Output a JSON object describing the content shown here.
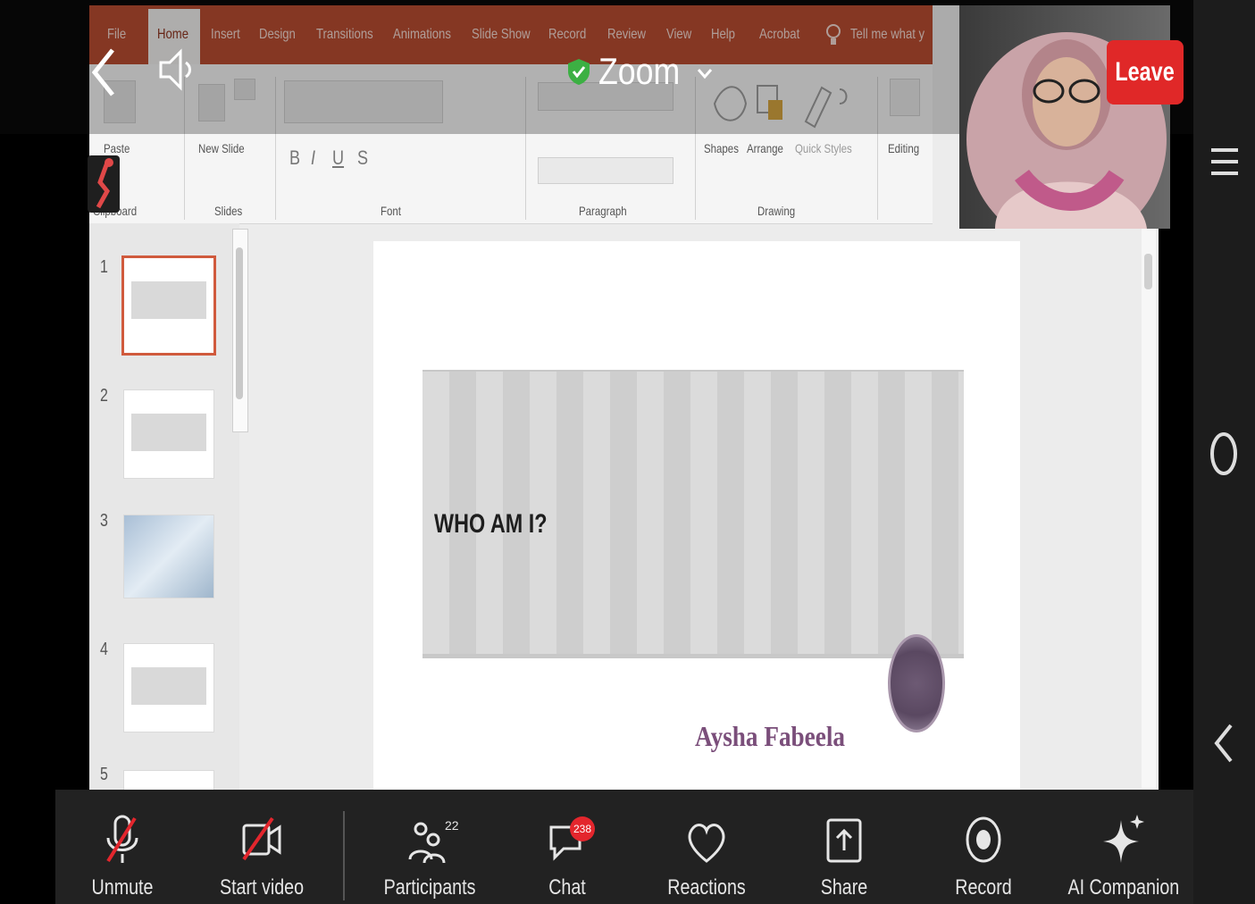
{
  "ribbon_tabs": [
    "File",
    "Home",
    "Insert",
    "Design",
    "Transitions",
    "Animations",
    "Slide Show",
    "Record",
    "Review",
    "View",
    "Help",
    "Acrobat",
    "Tell me what y"
  ],
  "ribbon_groups": {
    "clipboard": "Clipboard",
    "slides": "Slides",
    "font": "Font",
    "paragraph": "Paragraph",
    "drawing": "Drawing",
    "editing": "Editing"
  },
  "ribbon_buttons": {
    "paste": "Paste",
    "new_slide": "New Slide",
    "shapes": "Shapes",
    "arrange": "Arrange",
    "quick_styles": "Quick Styles",
    "bold": "B",
    "italic": "I",
    "underline": "U",
    "strike": "S"
  },
  "slide_numbers": [
    "1",
    "2",
    "3",
    "4",
    "5"
  ],
  "slide": {
    "title": "WHO AM I?",
    "presenter": "Aysha Fabeela"
  },
  "zoom": {
    "title": "Zoom",
    "leave": "Leave"
  },
  "controls": {
    "unmute": "Unmute",
    "start_video": "Start video",
    "participants": "Participants",
    "participants_count": "22",
    "chat": "Chat",
    "chat_badge": "238",
    "reactions": "Reactions",
    "share": "Share",
    "record": "Record",
    "ai_companion": "AI Companion"
  },
  "colors": {
    "ribbon_red": "#b7472a",
    "leave_red": "#e02828",
    "badge_red": "#e3262d",
    "presenter_text": "#7a4e7a"
  }
}
